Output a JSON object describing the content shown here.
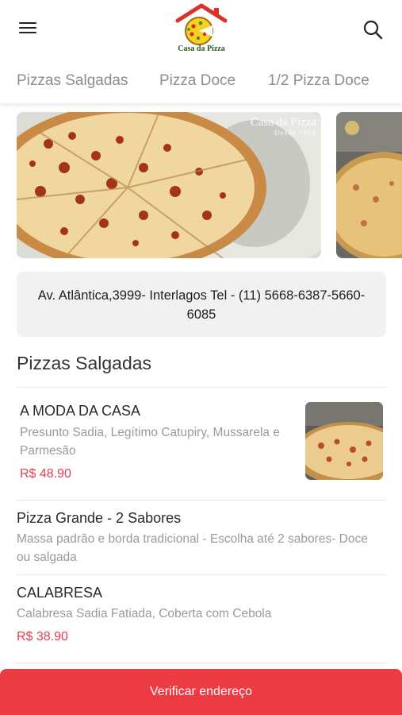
{
  "header": {
    "logo_text": "Casa da Pizza",
    "menu_icon": "hamburger-menu-icon",
    "search_icon": "search-icon"
  },
  "tabs": [
    {
      "label": "Pizzas Salgadas"
    },
    {
      "label": "Pizza Doce"
    },
    {
      "label": "1/2 Pizza Doce"
    }
  ],
  "banners": [
    {
      "brand": "Casa da Pizza",
      "since": "Desde 1998"
    }
  ],
  "address": {
    "text": "Av. Atlântica,3999- Interlagos Tel - (11) 5668-6387-5660-6085"
  },
  "section": {
    "title": "Pizzas Salgadas"
  },
  "items": [
    {
      "name": "A MODA DA CASA",
      "description": "Presunto Sadia, Legítimo Catupiry, Mussarela e Parmesão",
      "price": "R$ 48.90"
    },
    {
      "name": "Pizza Grande - 2 Sabores",
      "description": "Massa padrão e borda tradicional - Escolha até 2 sabores- Doce ou salgada"
    },
    {
      "name": "CALABRESA",
      "description": "Calabresa Sadia Fatiada, Coberta com Cebola",
      "price": "R$ 38.90"
    }
  ],
  "footer": {
    "button_label": "Verificar endereço"
  },
  "colors": {
    "accent_red": "#ec3b43",
    "price_red": "#e1404a",
    "address_bg": "#f1f1f1"
  }
}
